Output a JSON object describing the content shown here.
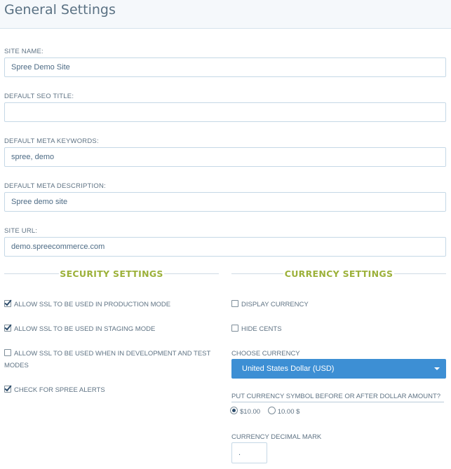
{
  "page": {
    "title": "General Settings"
  },
  "fields": [
    {
      "label": "SITE NAME:",
      "value": "Spree Demo Site"
    },
    {
      "label": "DEFAULT SEO TITLE:",
      "value": ""
    },
    {
      "label": "DEFAULT META KEYWORDS:",
      "value": "spree, demo"
    },
    {
      "label": "DEFAULT META DESCRIPTION:",
      "value": "Spree demo site"
    },
    {
      "label": "SITE URL:",
      "value": "demo.spreecommerce.com"
    }
  ],
  "security": {
    "heading": "SECURITY SETTINGS",
    "options": [
      {
        "label": "ALLOW SSL TO BE USED IN PRODUCTION MODE",
        "checked": true
      },
      {
        "label": "ALLOW SSL TO BE USED IN STAGING MODE",
        "checked": true
      },
      {
        "label": "ALLOW SSL TO BE USED WHEN IN DEVELOPMENT AND TEST",
        "label2": "MODES",
        "checked": false
      },
      {
        "label": "CHECK FOR SPREE ALERTS",
        "checked": true
      }
    ]
  },
  "currency": {
    "heading": "CURRENCY SETTINGS",
    "display_currency": {
      "label": "DISPLAY CURRENCY",
      "checked": false
    },
    "hide_cents": {
      "label": "HIDE CENTS",
      "checked": false
    },
    "choose_label": "CHOOSE CURRENCY",
    "selected_currency": "United States Dollar (USD)",
    "symbol_position_label": "PUT CURRENCY SYMBOL BEFORE OR AFTER DOLLAR AMOUNT?",
    "symbol_before": {
      "label": "$10.00",
      "selected": true
    },
    "symbol_after": {
      "label": "10.00 $",
      "selected": false
    },
    "decimal_mark_label": "CURRENCY DECIMAL MARK",
    "decimal_mark_value": "."
  },
  "colors": {
    "accent_green": "#9cb13a",
    "select_blue": "#3d8fd4",
    "text_slate": "#5f7384"
  }
}
